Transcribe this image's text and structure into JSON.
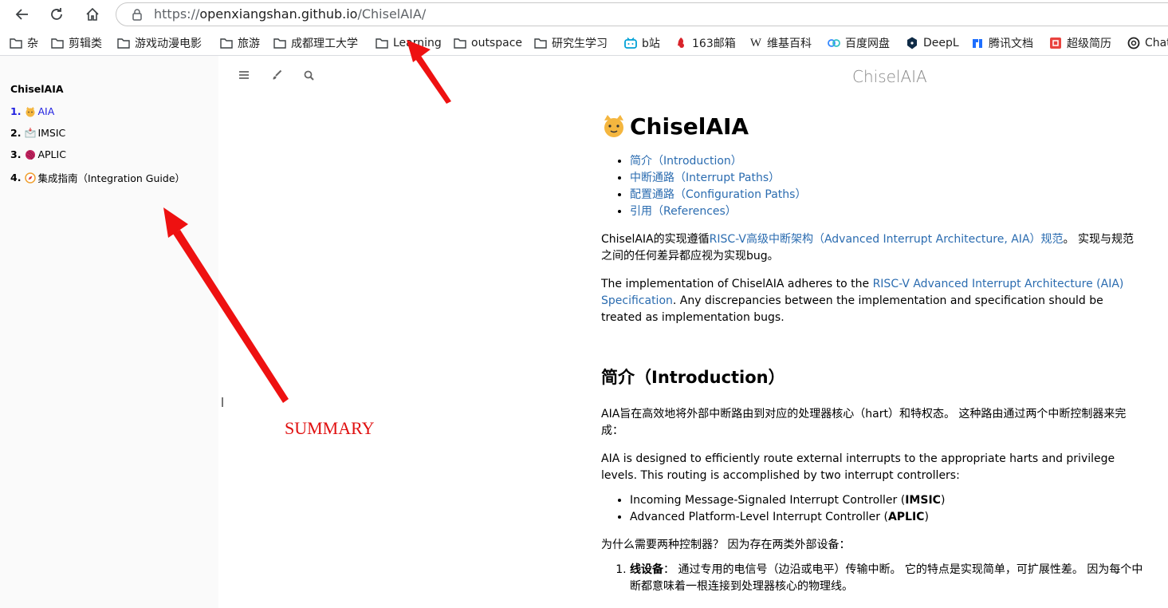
{
  "browser": {
    "url_scheme": "https://",
    "url_host": "openxiangshan.github.io",
    "url_path": "/ChiselAIA/"
  },
  "bookmarks": [
    {
      "label": "杂",
      "icon": "folder-icon"
    },
    {
      "label": "剪辑类",
      "icon": "folder-icon"
    },
    {
      "label": "游戏动漫电影",
      "icon": "folder-icon"
    },
    {
      "label": "旅游",
      "icon": "folder-icon"
    },
    {
      "label": "成都理工大学",
      "icon": "folder-icon"
    },
    {
      "label": "Learning",
      "icon": "folder-icon"
    },
    {
      "label": "outspace",
      "icon": "folder-icon"
    },
    {
      "label": "研究生学习",
      "icon": "folder-icon"
    },
    {
      "label": "b站",
      "icon": "bilibili-icon"
    },
    {
      "label": "163邮箱",
      "icon": "netease-icon"
    },
    {
      "label": "维基百科",
      "icon": "wikipedia-icon"
    },
    {
      "label": "百度网盘",
      "icon": "baidu-pan-icon"
    },
    {
      "label": "DeepL",
      "icon": "deepl-icon"
    },
    {
      "label": "腾讯文档",
      "icon": "tencent-docs-icon"
    },
    {
      "label": "超级简历",
      "icon": "resume-icon"
    },
    {
      "label": "Chat",
      "icon": "chatgpt-icon"
    }
  ],
  "sidebar": {
    "title": "ChiselAIA",
    "items": [
      {
        "num": "1.",
        "label": "AIA",
        "active": true
      },
      {
        "num": "2.",
        "label": "IMSIC",
        "active": false
      },
      {
        "num": "3.",
        "label": "APLIC",
        "active": false
      },
      {
        "num": "4.",
        "label": "集成指南（Integration Guide）",
        "active": false
      }
    ]
  },
  "header": {
    "book_title": "ChiselAIA"
  },
  "page": {
    "h1": "ChiselAIA",
    "toc": [
      "简介（Introduction）",
      "中断通路（Interrupt Paths）",
      "配置通路（Configuration Paths）",
      "引用（References）"
    ],
    "p1_pre": "ChiselAIA的实现遵循",
    "p1_link": "RISC-V高级中断架构（Advanced Interrupt Architecture, AIA）规范",
    "p1_post": "。 实现与规范之间的任何差异都应视为实现bug。",
    "p2_pre": "The implementation of ChiselAIA adheres to the ",
    "p2_link": "RISC-V Advanced Interrupt Architecture (AIA) Specification",
    "p2_post": ". Any discrepancies between the implementation and specification should be treated as implementation bugs.",
    "h2": "简介（Introduction）",
    "p3": "AIA旨在高效地将外部中断路由到对应的处理器核心（hart）和特权态。 这种路由通过两个中断控制器来完成：",
    "p4": "AIA is designed to efficiently route external interrupts to the appropriate harts and privilege levels. This routing is accomplished by two interrupt controllers:",
    "controllers": [
      {
        "pre": "Incoming Message-Signaled Interrupt Controller (",
        "bold": "IMSIC",
        "post": ")"
      },
      {
        "pre": "Advanced Platform-Level Interrupt Controller (",
        "bold": "APLIC",
        "post": ")"
      }
    ],
    "p5": "为什么需要两种控制器？ 因为存在两类外部设备：",
    "ol1_bold": "线设备",
    "ol1_text": "： 通过专用的电信号（边沿或电平）传输中断。 它的特点是实现简单，可扩展性差。 因为每个中断都意味着一根连接到处理器核心的物理线。"
  },
  "annotations": {
    "summary_label": "SUMMARY",
    "color": "#e01010"
  }
}
